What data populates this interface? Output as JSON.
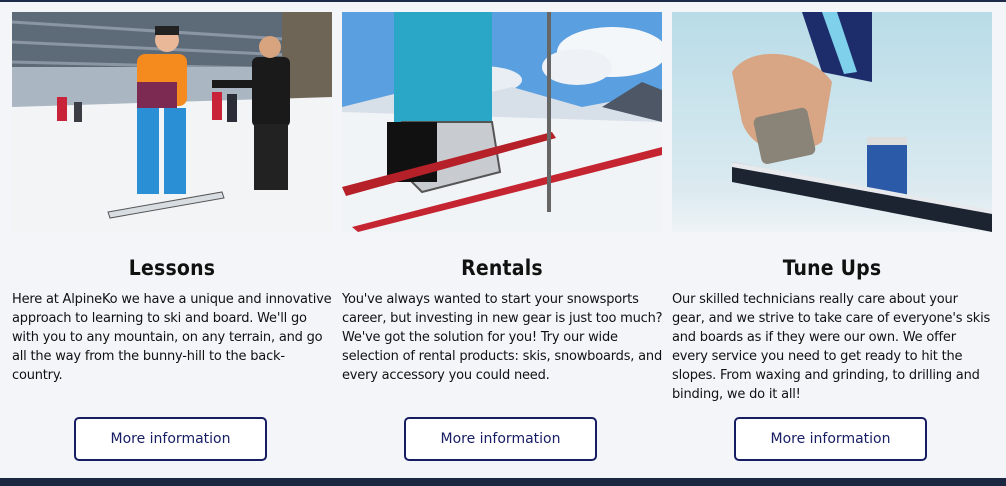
{
  "cards": [
    {
      "title": "Lessons",
      "text": "Here at AlpineKo we have a unique and innovative approach to learning to ski and board. We'll go with you to any mountain, on any terrain, and go all the way from the bunny-hill to the back-country.",
      "button_label": "More information",
      "image": "snowboard-lesson-photo"
    },
    {
      "title": "Rentals",
      "text": "You've always wanted to start your snowsports career, but investing in new gear is just too much? We've got the solution for you! Try our wide selection of rental products: skis, snowboards, and every accessory you could need.",
      "button_label": "More information",
      "image": "ski-boots-rental-photo"
    },
    {
      "title": "Tune Ups",
      "text": "Our skilled technicians really care about your gear, and we strive to take care of everyone's skis and boards as if they were our own. We offer every service you need to get ready to hit the slopes. From waxing and grinding, to drilling and binding, we do it all!",
      "button_label": "More information",
      "image": "ski-waxing-photo"
    }
  ],
  "colors": {
    "accent": "#171d63",
    "page_bg": "#f3f5f8",
    "bottom_bar": "#1b2640"
  }
}
